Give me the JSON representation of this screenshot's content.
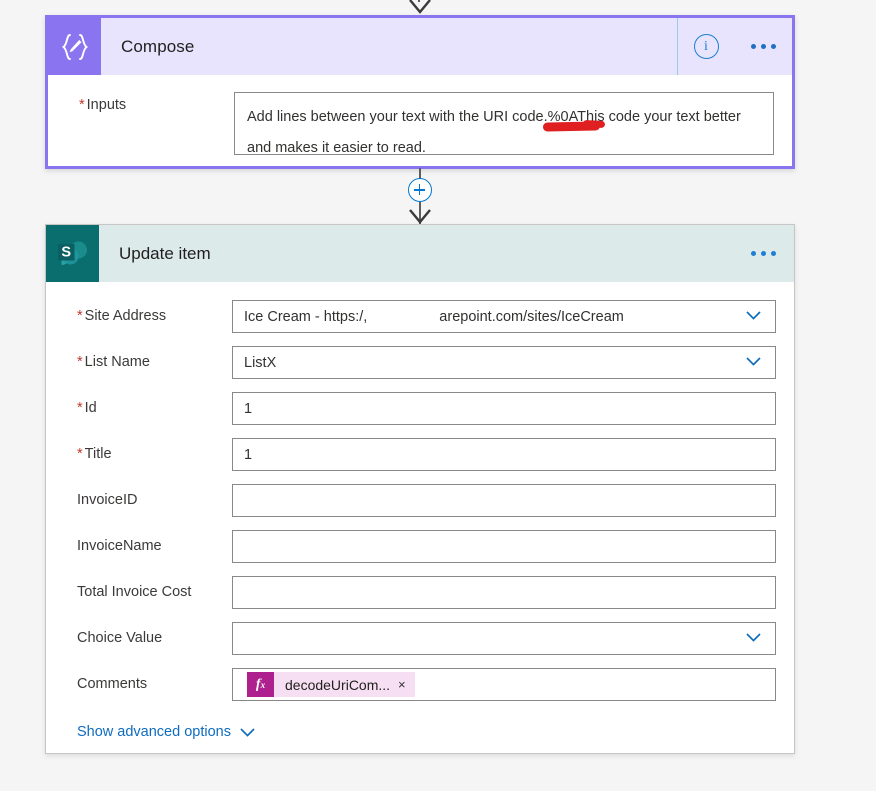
{
  "flow": {
    "connector_plus_label": "+",
    "compose": {
      "icon": "compose-braces-pencil-icon",
      "title": "Compose",
      "info_label": "i",
      "more_label": "...",
      "inputs": {
        "label": "Inputs",
        "required": true,
        "required_marker": "*",
        "line1": "Add lines between your text with the URI code.%0AThis code your text better",
        "line2": "and makes it easier to read.",
        "annotation": "red-underline-on-%0A"
      },
      "colors": {
        "border": "#8a74f0",
        "header_bg": "#e9e4fd",
        "icon_bg": "#8a74f0"
      }
    },
    "update_item": {
      "icon": "sharepoint-icon",
      "title": "Update item",
      "more_label": "...",
      "colors": {
        "header_bg": "#dceaea",
        "icon_bg": "#0b6e6e",
        "accent_link": "#0f6cbd"
      },
      "fields": [
        {
          "label": "Site Address",
          "required": true,
          "required_marker": "*",
          "value_prefix": "Ice Cream - https:/,",
          "value_masked": true,
          "value_suffix": "arepoint.com/sites/IceCream",
          "control": "dropdown",
          "has_chevron": true
        },
        {
          "label": "List Name",
          "required": true,
          "required_marker": "*",
          "value": "ListX",
          "control": "dropdown",
          "has_chevron": true
        },
        {
          "label": "Id",
          "required": true,
          "required_marker": "*",
          "value": "1",
          "control": "text",
          "has_chevron": false
        },
        {
          "label": "Title",
          "required": true,
          "required_marker": "*",
          "value": "1",
          "control": "text",
          "has_chevron": false
        },
        {
          "label": "InvoiceID",
          "required": false,
          "required_marker": "",
          "value": "",
          "control": "text",
          "has_chevron": false
        },
        {
          "label": "InvoiceName",
          "required": false,
          "required_marker": "",
          "value": "",
          "control": "text",
          "has_chevron": false
        },
        {
          "label": "Total Invoice Cost",
          "required": false,
          "required_marker": "",
          "value": "",
          "control": "text",
          "has_chevron": false
        },
        {
          "label": "Choice Value",
          "required": false,
          "required_marker": "",
          "value": "",
          "control": "dropdown",
          "has_chevron": true
        }
      ],
      "comments": {
        "label": "Comments",
        "token": {
          "fx_label": "fx",
          "text": "decodeUriCom...",
          "remove_label": "×"
        }
      },
      "advanced_options": {
        "label": "Show advanced options",
        "icon": "chevron-down-icon"
      }
    }
  }
}
